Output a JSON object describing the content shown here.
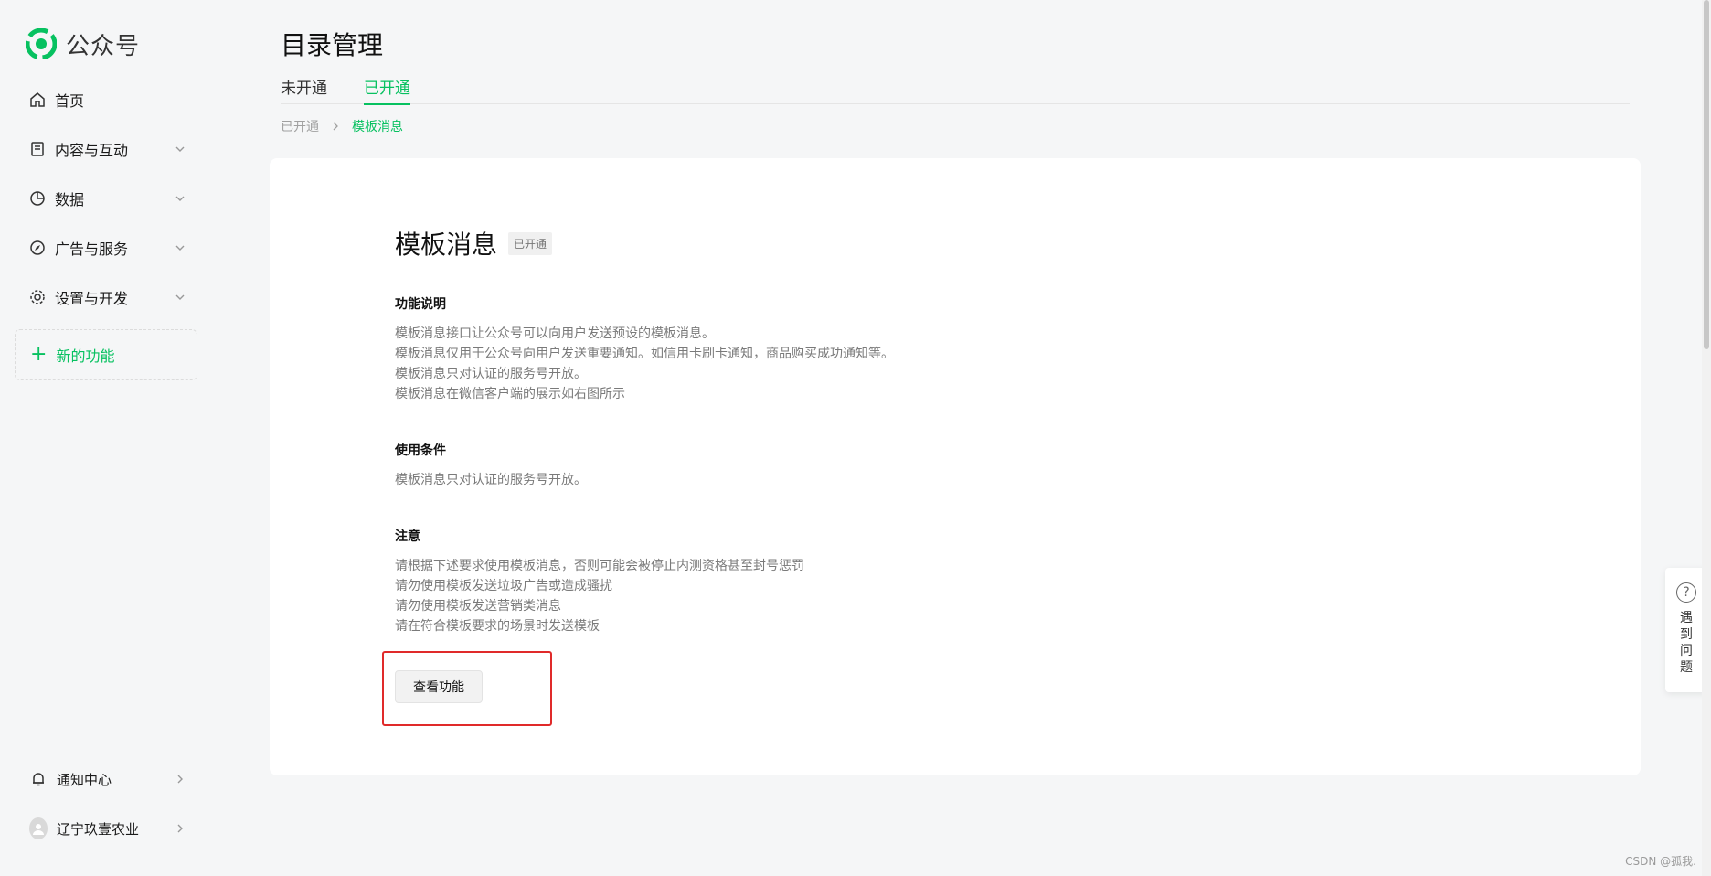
{
  "app": {
    "brand_name": "公众号"
  },
  "sidebar": {
    "items": [
      {
        "label": "首页",
        "icon": "home-icon",
        "expandable": false
      },
      {
        "label": "内容与互动",
        "icon": "document-icon",
        "expandable": true
      },
      {
        "label": "数据",
        "icon": "pie-chart-icon",
        "expandable": true
      },
      {
        "label": "广告与服务",
        "icon": "compass-icon",
        "expandable": true
      },
      {
        "label": "设置与开发",
        "icon": "gear-icon",
        "expandable": true
      }
    ],
    "new_feature_label": "新的功能",
    "bottom": {
      "notifications_label": "通知中心",
      "account_name": "辽宁玖壹农业"
    }
  },
  "header": {
    "title": "目录管理",
    "tabs": [
      {
        "label": "未开通",
        "active": false
      },
      {
        "label": "已开通",
        "active": true
      }
    ]
  },
  "breadcrumb": {
    "root": "已开通",
    "current": "模板消息"
  },
  "feature": {
    "title": "模板消息",
    "status": "已开通",
    "sections": [
      {
        "title": "功能说明",
        "lines": [
          "模板消息接口让公众号可以向用户发送预设的模板消息。",
          "模板消息仅用于公众号向用户发送重要通知。如信用卡刷卡通知，商品购买成功通知等。",
          "模板消息只对认证的服务号开放。",
          "模板消息在微信客户端的展示如右图所示"
        ]
      },
      {
        "title": "使用条件",
        "lines": [
          "模板消息只对认证的服务号开放。"
        ]
      },
      {
        "title": "注意",
        "lines": [
          "请根据下述要求使用模板消息，否则可能会被停止内测资格甚至封号惩罚",
          "请勿使用模板发送垃圾广告或造成骚扰",
          "请勿使用模板发送营销类消息",
          "请在符合模板要求的场景时发送模板"
        ]
      }
    ],
    "view_button_label": "查看功能"
  },
  "help_float": {
    "label_chars": [
      "遇",
      "到",
      "问",
      "题"
    ]
  },
  "watermark": "CSDN @孤我.",
  "colors": {
    "accent": "#07c160",
    "highlight": "#e02a2a"
  }
}
